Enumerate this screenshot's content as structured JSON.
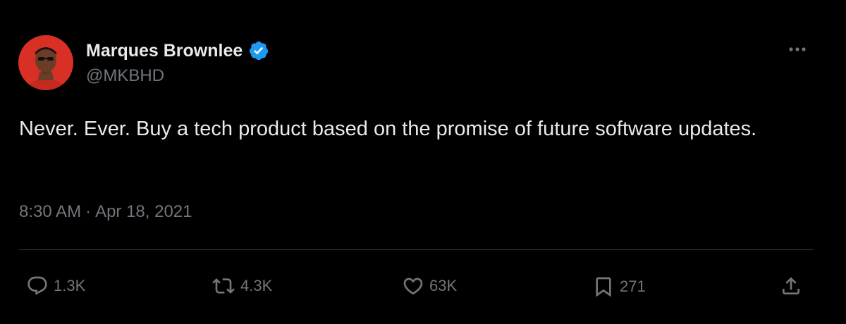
{
  "author": {
    "display_name": "Marques Brownlee",
    "handle": "@MKBHD",
    "verified_icon": "verified-badge-icon",
    "avatar_icon": "avatar"
  },
  "tweet": {
    "text": "Never. Ever. Buy a tech product based on the promise of future software updates.",
    "time": "8:30 AM",
    "separator": "·",
    "date": "Apr 18, 2021"
  },
  "actions": {
    "reply": {
      "icon": "reply-icon",
      "count": "1.3K"
    },
    "retweet": {
      "icon": "retweet-icon",
      "count": "4.3K"
    },
    "like": {
      "icon": "heart-icon",
      "count": "63K"
    },
    "bookmark": {
      "icon": "bookmark-icon",
      "count": "271"
    },
    "share": {
      "icon": "share-icon"
    }
  },
  "menu": {
    "icon": "more-options-icon"
  },
  "colors": {
    "background": "#000000",
    "text": "#e7e9ea",
    "secondary": "#71767b",
    "divider": "#2f3336",
    "verified": "#1d9bf0",
    "avatar_bg": "#d93025"
  }
}
